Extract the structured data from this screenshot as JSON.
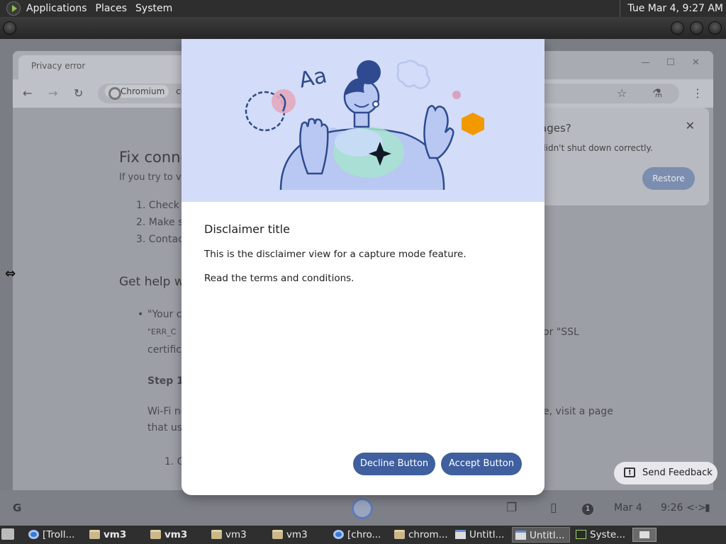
{
  "top_panel": {
    "menus": [
      "Applications",
      "Places",
      "System"
    ],
    "clock": "Tue Mar  4,  9:27 AM"
  },
  "browser": {
    "tab_title": "Privacy error",
    "omnibox_chip": "Chromium",
    "omnibox_text": "chr",
    "page": {
      "heading": "Fix conne",
      "intro": "If you try to vis",
      "steps": [
        "1. Check",
        "2. Make s",
        "3. Contac"
      ],
      "help_heading": "Get help wi",
      "bullet_line1": "\"Your c",
      "bullet_line2": "\"ERR_C",
      "bullet_line2_right": "or \"SSL",
      "bullet_line3": "certifica",
      "step_heading": "Step 1:",
      "wifi_line1": "Wi-Fi ne",
      "wifi_line1_right": "e, visit a page",
      "wifi_line2": "that use",
      "sub_step": "1. G"
    },
    "restore_bubble": {
      "title": "ages?",
      "message": "didn't shut down correctly.",
      "button": "Restore"
    }
  },
  "dialog": {
    "title": "Disclaimer title",
    "text1": "This is the disclaimer view for a capture mode feature.",
    "text2": "Read the terms and conditions.",
    "decline": "Decline Button",
    "accept": "Accept Button",
    "illustration_text": "Aa"
  },
  "feedback_button": "Send Feedback",
  "shelf": {
    "launcher_letter": "G",
    "date": "Mar 4",
    "time": "9:26",
    "notification_count": "1"
  },
  "taskbar": {
    "items": [
      {
        "label": "[Troll...",
        "icon": "chrome-icon"
      },
      {
        "label": "vm3",
        "icon": "folder-icon"
      },
      {
        "label": "vm3",
        "icon": "folder-icon"
      },
      {
        "label": "vm3",
        "icon": "folder-icon"
      },
      {
        "label": "vm3",
        "icon": "folder-icon"
      },
      {
        "label": "[chro...",
        "icon": "chrome-icon"
      },
      {
        "label": "chrom...",
        "icon": "folder-icon"
      },
      {
        "label": "Untitl...",
        "icon": "window-icon"
      },
      {
        "label": "Untitl...",
        "icon": "window-icon"
      },
      {
        "label": "Syste...",
        "icon": "system-monitor-icon"
      }
    ]
  },
  "colors": {
    "accent_button": "#3f5f9e",
    "illustration_bg": "#d3dcf8",
    "hexagon": "#f29900"
  }
}
